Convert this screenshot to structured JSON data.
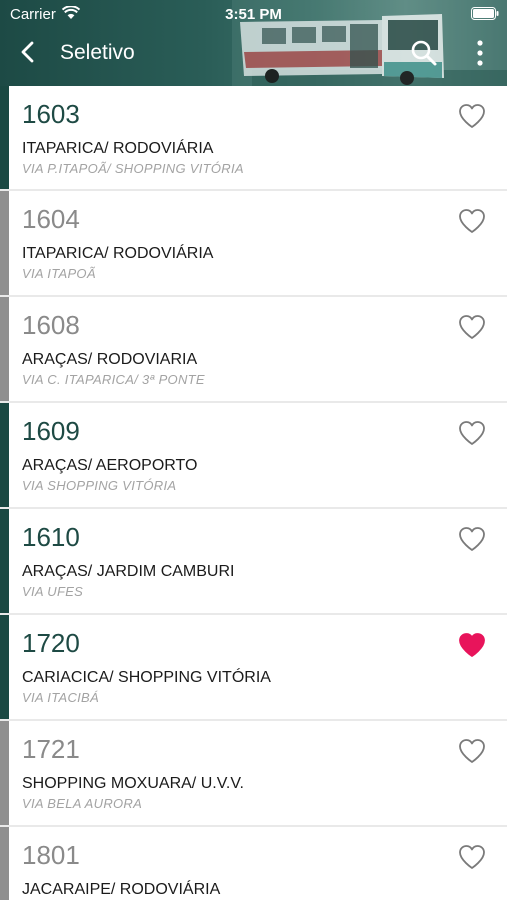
{
  "status_bar": {
    "carrier": "Carrier",
    "time": "3:51 PM"
  },
  "nav": {
    "title": "Seletivo"
  },
  "colors": {
    "active": "#1a4842",
    "inactive": "#8f8f8f",
    "favorite": "#e8145b"
  },
  "routes": [
    {
      "number": "1603",
      "name": "ITAPARICA/ RODOVIÁRIA",
      "via": "VIA P.ITAPOÃ/ SHOPPING VITÓRIA",
      "active": true,
      "favorite": false
    },
    {
      "number": "1604",
      "name": "ITAPARICA/ RODOVIÁRIA",
      "via": "VIA ITAPOÃ",
      "active": false,
      "favorite": false
    },
    {
      "number": "1608",
      "name": "ARAÇAS/ RODOVIARIA",
      "via": "VIA C. ITAPARICA/ 3ª PONTE",
      "active": false,
      "favorite": false
    },
    {
      "number": "1609",
      "name": "ARAÇAS/ AEROPORTO",
      "via": "VIA SHOPPING VITÓRIA",
      "active": true,
      "favorite": false
    },
    {
      "number": "1610",
      "name": "ARAÇAS/ JARDIM CAMBURI",
      "via": "VIA UFES",
      "active": true,
      "favorite": false
    },
    {
      "number": "1720",
      "name": "CARIACICA/ SHOPPING VITÓRIA",
      "via": "VIA ITACIBÁ",
      "active": true,
      "favorite": true
    },
    {
      "number": "1721",
      "name": "SHOPPING MOXUARA/ U.V.V.",
      "via": "VIA BELA AURORA",
      "active": false,
      "favorite": false
    },
    {
      "number": "1801",
      "name": "JACARAIPE/ RODOVIÁRIA",
      "via": "",
      "active": false,
      "favorite": false
    }
  ]
}
